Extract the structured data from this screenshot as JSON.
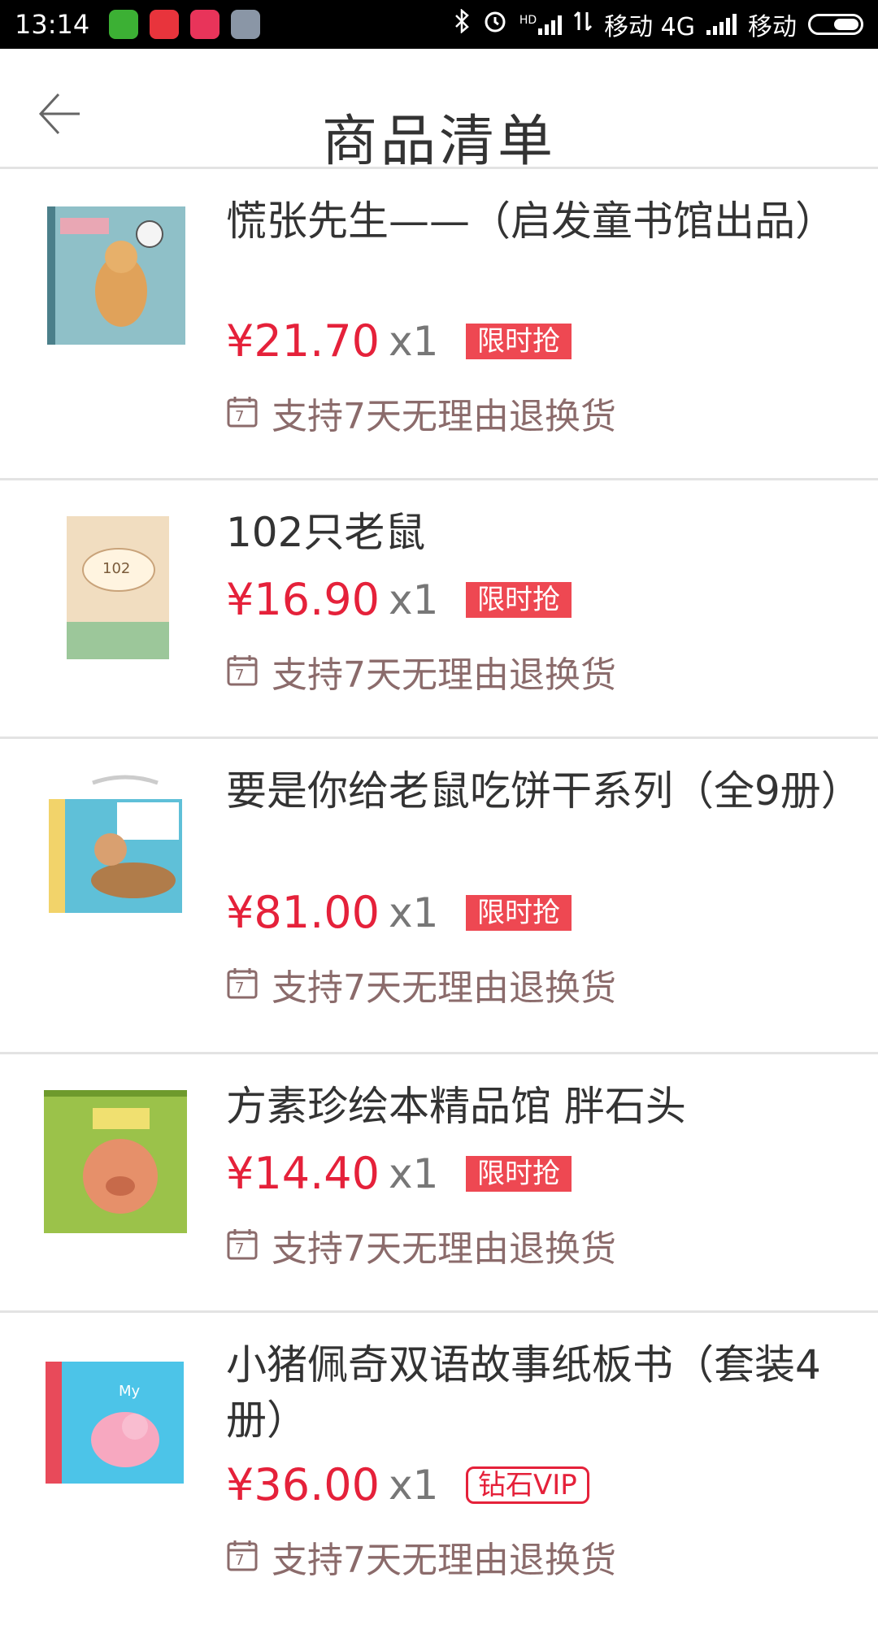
{
  "status_bar": {
    "time": "13:14",
    "carrier1": "移动 4G",
    "carrier2": "移动",
    "hd_label": "HD"
  },
  "header": {
    "title": "商品清单",
    "back_icon": "arrow-left-icon"
  },
  "items": [
    {
      "title": "慌张先生——（启发童书馆出品）",
      "price": "¥21.70",
      "qty": "x1",
      "badge": "限时抢",
      "return_text": "支持7天无理由退换货"
    },
    {
      "title": "102只老鼠",
      "price": "¥16.90",
      "qty": "x1",
      "badge": "限时抢",
      "return_text": "支持7天无理由退换货"
    },
    {
      "title": "要是你给老鼠吃饼干系列（全9册）",
      "price": "¥81.00",
      "qty": "x1",
      "badge": "限时抢",
      "return_text": "支持7天无理由退换货"
    },
    {
      "title": "方素珍绘本精品馆 胖石头",
      "price": "¥14.40",
      "qty": "x1",
      "badge": "限时抢",
      "return_text": "支持7天无理由退换货"
    },
    {
      "title": "小猪佩奇双语故事纸板书（套装4册）",
      "price": "¥36.00",
      "qty": "x1",
      "badge": "钻石VIP",
      "return_text": "支持7天无理由退换货"
    }
  ],
  "colors": {
    "price": "#e5213a",
    "badge": "#ee4852",
    "return_text": "#8b6b6b"
  }
}
